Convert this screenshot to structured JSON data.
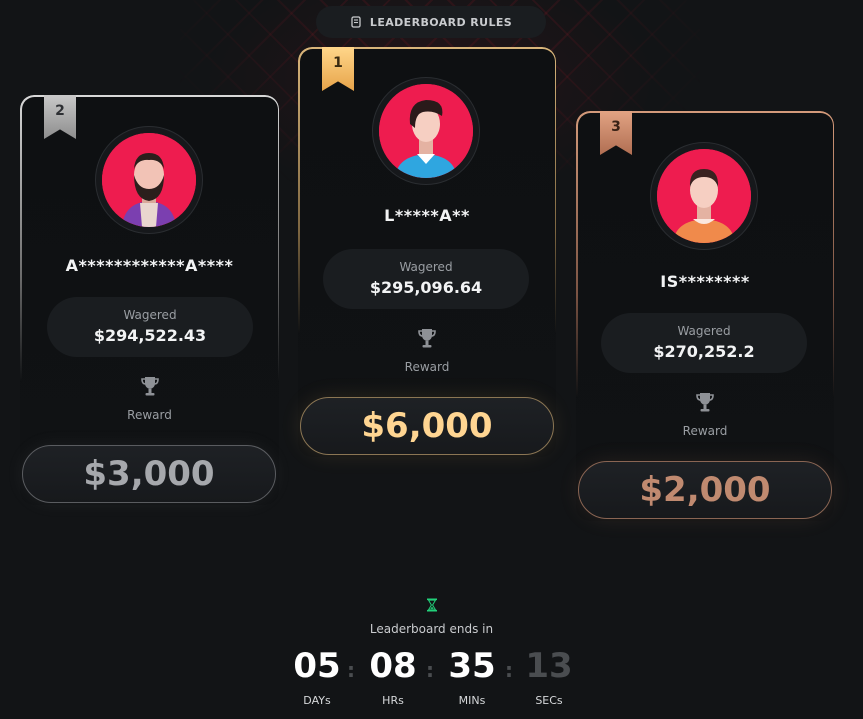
{
  "header": {
    "rules_label": "LEADERBOARD RULES",
    "rules_icon": "scroll-icon"
  },
  "podium": [
    {
      "rank": "2",
      "username": "A************A****",
      "wagered_label": "Wagered",
      "wagered_value": "$294,522.43",
      "reward_label": "Reward",
      "prize": "$3,000",
      "accent_color": "#a6a8ac"
    },
    {
      "rank": "1",
      "username": "L*****A**",
      "wagered_label": "Wagered",
      "wagered_value": "$295,096.64",
      "reward_label": "Reward",
      "prize": "$6,000",
      "accent_color": "#ffd592"
    },
    {
      "rank": "3",
      "username": "IS********",
      "wagered_label": "Wagered",
      "wagered_value": "$270,252.2",
      "reward_label": "Reward",
      "prize": "$2,000",
      "accent_color": "#c08a70"
    }
  ],
  "timer": {
    "icon": "hourglass-icon",
    "label": "Leaderboard ends in",
    "days": "05",
    "days_label": "DAYs",
    "hours": "08",
    "hours_label": "HRs",
    "minutes": "35",
    "minutes_label": "MINs",
    "seconds": "13",
    "seconds_label": "SECs",
    "separator": ":"
  }
}
